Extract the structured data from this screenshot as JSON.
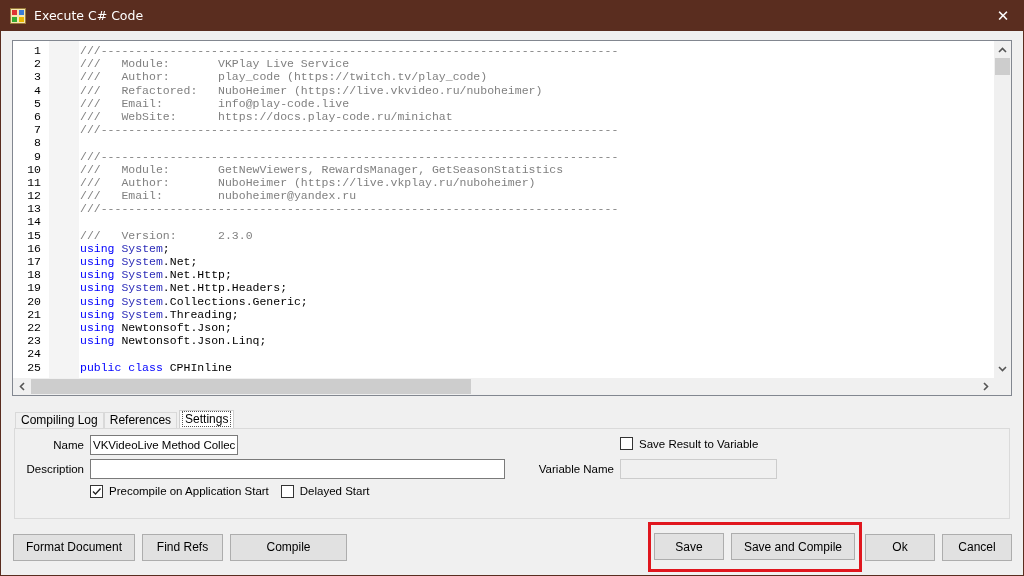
{
  "window": {
    "title": "Execute C# Code",
    "close": "✕"
  },
  "editor": {
    "lines": [
      {
        "number": "1",
        "segments": [
          {
            "kind": "comment",
            "text": "///---------------------------------------------------------------------------"
          }
        ]
      },
      {
        "number": "2",
        "segments": [
          {
            "kind": "comment",
            "text": "///   Module:       VKPlay Live Service"
          }
        ]
      },
      {
        "number": "3",
        "segments": [
          {
            "kind": "comment",
            "text": "///   Author:       play_code (https://twitch.tv/play_code)"
          }
        ]
      },
      {
        "number": "4",
        "segments": [
          {
            "kind": "comment",
            "text": "///   Refactored:   NuboHeimer (https://live.vkvideo.ru/nuboheimer)"
          }
        ]
      },
      {
        "number": "5",
        "segments": [
          {
            "kind": "comment",
            "text": "///   Email:        info@play-code.live"
          }
        ]
      },
      {
        "number": "6",
        "segments": [
          {
            "kind": "comment",
            "text": "///   WebSite:      https://docs.play-code.ru/minichat"
          }
        ]
      },
      {
        "number": "7",
        "segments": [
          {
            "kind": "comment",
            "text": "///---------------------------------------------------------------------------"
          }
        ]
      },
      {
        "number": "8"
      },
      {
        "number": "9",
        "segments": [
          {
            "kind": "comment",
            "text": "///---------------------------------------------------------------------------"
          }
        ]
      },
      {
        "number": "10",
        "segments": [
          {
            "kind": "comment",
            "text": "///   Module:       GetNewViewers, RewardsManager, GetSeasonStatistics"
          }
        ]
      },
      {
        "number": "11",
        "segments": [
          {
            "kind": "comment",
            "text": "///   Author:       NuboHeimer (https://live.vkplay.ru/nuboheimer)"
          }
        ]
      },
      {
        "number": "12",
        "segments": [
          {
            "kind": "comment",
            "text": "///   Email:        nuboheimer@yandex.ru"
          }
        ]
      },
      {
        "number": "13",
        "segments": [
          {
            "kind": "comment",
            "text": "///---------------------------------------------------------------------------"
          }
        ]
      },
      {
        "number": "14"
      },
      {
        "number": "15",
        "segments": [
          {
            "kind": "comment",
            "text": "///   Version:      2.3.0"
          }
        ]
      },
      {
        "number": "16",
        "segments": [
          {
            "kind": "keyword",
            "text": "using "
          },
          {
            "kind": "namespace",
            "text": "System"
          },
          {
            "kind": "plain",
            "text": ";"
          }
        ]
      },
      {
        "number": "17",
        "segments": [
          {
            "kind": "keyword",
            "text": "using "
          },
          {
            "kind": "namespace",
            "text": "System"
          },
          {
            "kind": "plain",
            "text": ".Net;"
          }
        ]
      },
      {
        "number": "18",
        "segments": [
          {
            "kind": "keyword",
            "text": "using "
          },
          {
            "kind": "namespace",
            "text": "System"
          },
          {
            "kind": "plain",
            "text": ".Net.Http;"
          }
        ]
      },
      {
        "number": "19",
        "segments": [
          {
            "kind": "keyword",
            "text": "using "
          },
          {
            "kind": "namespace",
            "text": "System"
          },
          {
            "kind": "plain",
            "text": ".Net.Http.Headers;"
          }
        ]
      },
      {
        "number": "20",
        "segments": [
          {
            "kind": "keyword",
            "text": "using "
          },
          {
            "kind": "namespace",
            "text": "System"
          },
          {
            "kind": "plain",
            "text": ".Collections.Generic;"
          }
        ]
      },
      {
        "number": "21",
        "segments": [
          {
            "kind": "keyword",
            "text": "using "
          },
          {
            "kind": "namespace",
            "text": "System"
          },
          {
            "kind": "plain",
            "text": ".Threading;"
          }
        ]
      },
      {
        "number": "22",
        "segments": [
          {
            "kind": "keyword",
            "text": "using "
          },
          {
            "kind": "plain",
            "text": "Newtonsoft.Json;"
          }
        ]
      },
      {
        "number": "23",
        "segments": [
          {
            "kind": "keyword",
            "text": "using "
          },
          {
            "kind": "plain",
            "text": "Newtonsoft.Json.Linq;"
          }
        ]
      },
      {
        "number": "24"
      },
      {
        "number": "25",
        "segments": [
          {
            "kind": "keyword",
            "text": "public class "
          },
          {
            "kind": "plain",
            "text": "CPHInline"
          }
        ]
      }
    ]
  },
  "tabs": [
    {
      "label": "Compiling Log",
      "selected": false
    },
    {
      "label": "References",
      "selected": false
    },
    {
      "label": "Settings",
      "selected": true
    }
  ],
  "settings": {
    "name": {
      "label": "Name",
      "value": "VKVideoLive Method Collec"
    },
    "description": {
      "label": "Description"
    },
    "options": [
      {
        "label": "Precompile on Application Start",
        "checked": true
      },
      {
        "label": "Delayed Start",
        "checked": false
      }
    ],
    "save_result": {
      "label": "Save Result to Variable",
      "checked": false
    },
    "variable_name": {
      "label": "Variable Name",
      "disabled": true
    }
  },
  "left_buttons": [
    "Format Document",
    "Find Refs",
    "Compile"
  ],
  "right_buttons": [
    {
      "label": "Save",
      "highlighted": true
    },
    {
      "label": "Save and Compile",
      "highlighted": true
    },
    {
      "label": "Ok",
      "highlighted": false
    },
    {
      "label": "Cancel",
      "highlighted": false
    }
  ]
}
